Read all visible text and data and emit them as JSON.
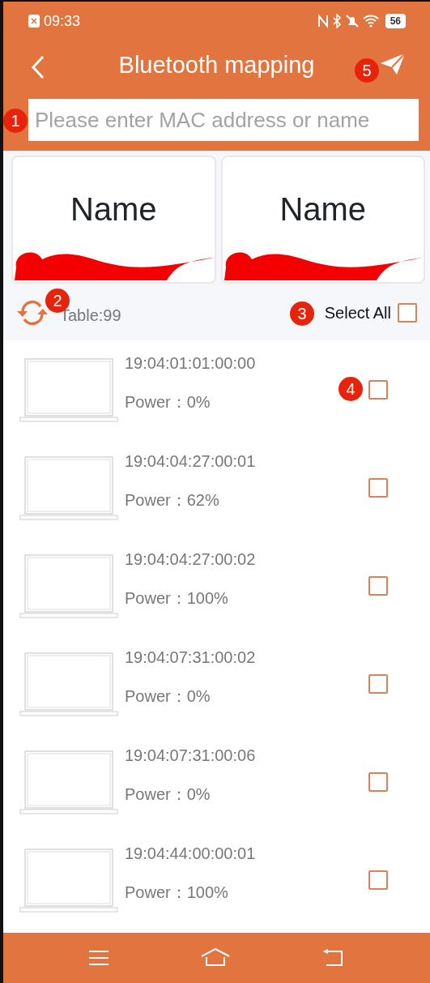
{
  "status_bar": {
    "time": "09:33",
    "battery": "56"
  },
  "header": {
    "title": "Bluetooth mapping",
    "callout": "5"
  },
  "search": {
    "placeholder": "Please enter MAC address or name",
    "callout": "1"
  },
  "name_cards": [
    {
      "label": "Name"
    },
    {
      "label": "Name"
    }
  ],
  "toolbar": {
    "count": "Table:99",
    "callout_refresh": "2",
    "select_all": {
      "label": "Select All",
      "checked": false
    },
    "callout_select": "3"
  },
  "devices": [
    {
      "mac": "19:04:01:01:00:00",
      "power": "Power：0%",
      "checked": false,
      "callout": "4"
    },
    {
      "mac": "19:04:04:27:00:01",
      "power": "Power：62%",
      "checked": false
    },
    {
      "mac": "19:04:04:27:00:02",
      "power": "Power：100%",
      "checked": false
    },
    {
      "mac": "19:04:07:31:00:02",
      "power": "Power：0%",
      "checked": false
    },
    {
      "mac": "19:04:07:31:00:06",
      "power": "Power：0%",
      "checked": false
    },
    {
      "mac": "19:04:44:00:00:01",
      "power": "Power：100%",
      "checked": false
    }
  ]
}
